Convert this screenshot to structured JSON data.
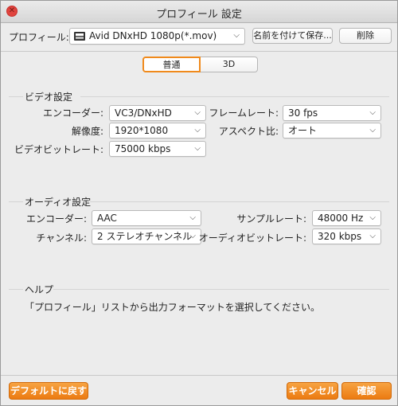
{
  "window": {
    "title": "プロフィール 設定",
    "close_glyph": "✕"
  },
  "profile": {
    "label": "プロフィール:",
    "selected": "Avid DNxHD 1080p(*.mov)",
    "save_as_label": "名前を付けて保存...",
    "delete_label": "削除"
  },
  "tabs": [
    {
      "label": "普通",
      "active": true
    },
    {
      "label": "3D",
      "active": false
    }
  ],
  "video": {
    "section_title": "ビデオ設定",
    "encoder_label": "エンコーダー:",
    "encoder_value": "VC3/DNxHD",
    "framerate_label": "フレームレート:",
    "framerate_value": "30 fps",
    "resolution_label": "解像度:",
    "resolution_value": "1920*1080",
    "aspect_label": "アスペクト比:",
    "aspect_value": "オート",
    "bitrate_label": "ビデオビットレート:",
    "bitrate_value": "75000 kbps"
  },
  "audio": {
    "section_title": "オーディオ設定",
    "encoder_label": "エンコーダー:",
    "encoder_value": "AAC",
    "samplerate_label": "サンプルレート:",
    "samplerate_value": "48000 Hz",
    "channel_label": "チャンネル:",
    "channel_value": "2 ステレオチャンネル",
    "bitrate_label": "オーディオビットレート:",
    "bitrate_value": "320 kbps"
  },
  "help": {
    "section_title": "ヘルプ",
    "text": "「プロフィール」リストから出力フォーマットを選択してください。"
  },
  "footer": {
    "default_label": "デフォルトに戻す",
    "cancel_label": "キャンセル",
    "ok_label": "確認"
  },
  "colors": {
    "accent": "#f08a1c",
    "close": "#e0443e"
  }
}
